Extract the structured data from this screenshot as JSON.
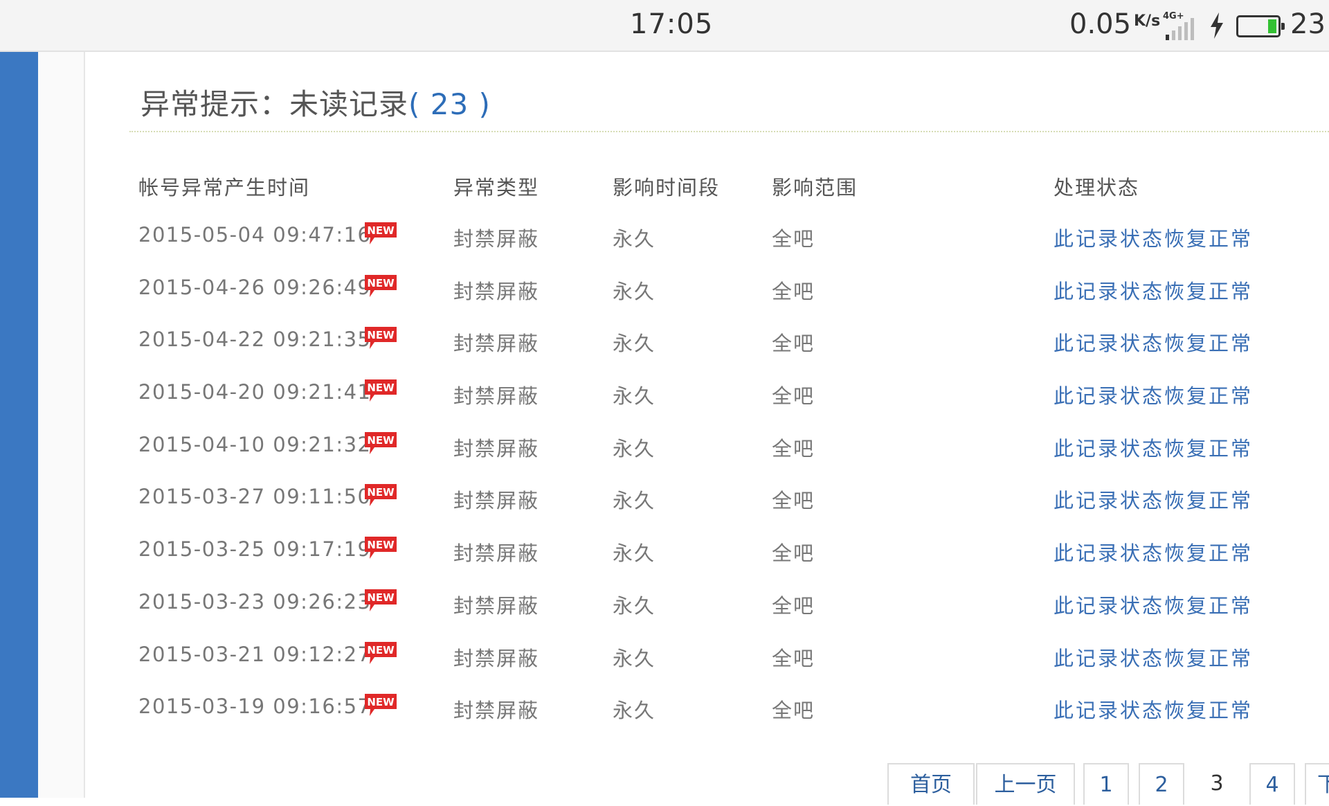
{
  "status_bar": {
    "time": "17:05",
    "speed": "0.05",
    "speed_unit": "K/s",
    "network": "4G+",
    "battery_level": "23",
    "battery_color": "#33c133"
  },
  "header": {
    "title": "异常提示：未读记录",
    "count": "( 23 )",
    "count_color": "#2d6db8"
  },
  "table": {
    "columns": [
      "帐号异常产生时间",
      "异常类型",
      "影响时间段",
      "影响范围",
      "处理状态"
    ],
    "rows": [
      {
        "time": "2015-05-04 09:47:16",
        "badge": "NEW",
        "type": "封禁屏蔽",
        "duration": "永久",
        "scope": "全吧",
        "status": "此记录状态恢复正常"
      },
      {
        "time": "2015-04-26 09:26:49",
        "badge": "NEW",
        "type": "封禁屏蔽",
        "duration": "永久",
        "scope": "全吧",
        "status": "此记录状态恢复正常"
      },
      {
        "time": "2015-04-22 09:21:35",
        "badge": "NEW",
        "type": "封禁屏蔽",
        "duration": "永久",
        "scope": "全吧",
        "status": "此记录状态恢复正常"
      },
      {
        "time": "2015-04-20 09:21:41",
        "badge": "NEW",
        "type": "封禁屏蔽",
        "duration": "永久",
        "scope": "全吧",
        "status": "此记录状态恢复正常"
      },
      {
        "time": "2015-04-10 09:21:32",
        "badge": "NEW",
        "type": "封禁屏蔽",
        "duration": "永久",
        "scope": "全吧",
        "status": "此记录状态恢复正常"
      },
      {
        "time": "2015-03-27 09:11:50",
        "badge": "NEW",
        "type": "封禁屏蔽",
        "duration": "永久",
        "scope": "全吧",
        "status": "此记录状态恢复正常"
      },
      {
        "time": "2015-03-25 09:17:19",
        "badge": "NEW",
        "type": "封禁屏蔽",
        "duration": "永久",
        "scope": "全吧",
        "status": "此记录状态恢复正常"
      },
      {
        "time": "2015-03-23 09:26:23",
        "badge": "NEW",
        "type": "封禁屏蔽",
        "duration": "永久",
        "scope": "全吧",
        "status": "此记录状态恢复正常"
      },
      {
        "time": "2015-03-21 09:12:27",
        "badge": "NEW",
        "type": "封禁屏蔽",
        "duration": "永久",
        "scope": "全吧",
        "status": "此记录状态恢复正常"
      },
      {
        "time": "2015-03-19 09:16:57",
        "badge": "NEW",
        "type": "封禁屏蔽",
        "duration": "永久",
        "scope": "全吧",
        "status": "此记录状态恢复正常"
      }
    ]
  },
  "pagination": {
    "first": "首页",
    "prev": "上一页",
    "pages": [
      "1",
      "2",
      "3",
      "4"
    ],
    "current": "3"
  },
  "colors": {
    "accent_blue": "#3b78c2",
    "link_blue": "#3a6fb5",
    "badge_red": "#e02828"
  }
}
